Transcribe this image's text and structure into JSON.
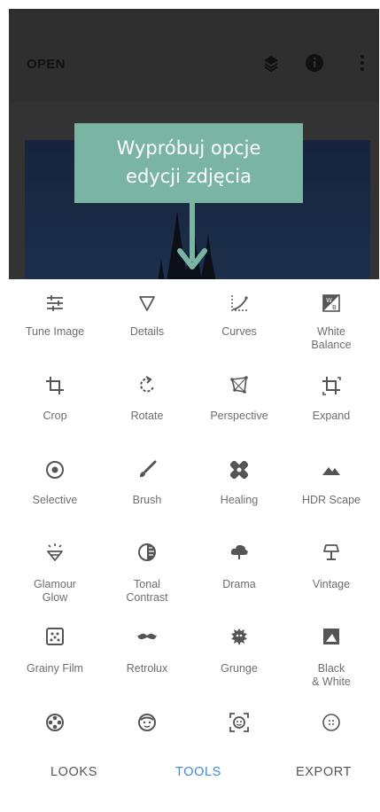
{
  "header": {
    "open_label": "OPEN"
  },
  "tooltip": {
    "line1": "Wypróbuj opcje",
    "line2": "edycji zdjęcia"
  },
  "tools": [
    {
      "label": "Tune Image",
      "icon": "tune-icon"
    },
    {
      "label": "Details",
      "icon": "triangle-icon"
    },
    {
      "label": "Curves",
      "icon": "curves-icon"
    },
    {
      "label": "White\nBalance",
      "icon": "white-balance-icon"
    },
    {
      "label": "Crop",
      "icon": "crop-icon"
    },
    {
      "label": "Rotate",
      "icon": "rotate-icon"
    },
    {
      "label": "Perspective",
      "icon": "perspective-icon"
    },
    {
      "label": "Expand",
      "icon": "expand-icon"
    },
    {
      "label": "Selective",
      "icon": "target-icon"
    },
    {
      "label": "Brush",
      "icon": "brush-icon"
    },
    {
      "label": "Healing",
      "icon": "bandage-icon"
    },
    {
      "label": "HDR Scape",
      "icon": "mountain-icon"
    },
    {
      "label": "Glamour\nGlow",
      "icon": "glow-icon"
    },
    {
      "label": "Tonal\nContrast",
      "icon": "contrast-icon"
    },
    {
      "label": "Drama",
      "icon": "cloud-icon"
    },
    {
      "label": "Vintage",
      "icon": "lamp-icon"
    },
    {
      "label": "Grainy Film",
      "icon": "film-grain-icon"
    },
    {
      "label": "Retrolux",
      "icon": "mustache-icon"
    },
    {
      "label": "Grunge",
      "icon": "grunge-icon"
    },
    {
      "label": "Black\n& White",
      "icon": "black-white-icon"
    },
    {
      "label": "",
      "icon": "film-reel-icon"
    },
    {
      "label": "",
      "icon": "face-icon"
    },
    {
      "label": "",
      "icon": "face-frame-icon"
    },
    {
      "label": "",
      "icon": "dots-circle-icon"
    }
  ],
  "nav": {
    "looks": "LOOKS",
    "tools": "TOOLS",
    "export": "EXPORT"
  },
  "colors": {
    "accent": "#3c8ad9",
    "tooltip": "#7ab5a4"
  }
}
